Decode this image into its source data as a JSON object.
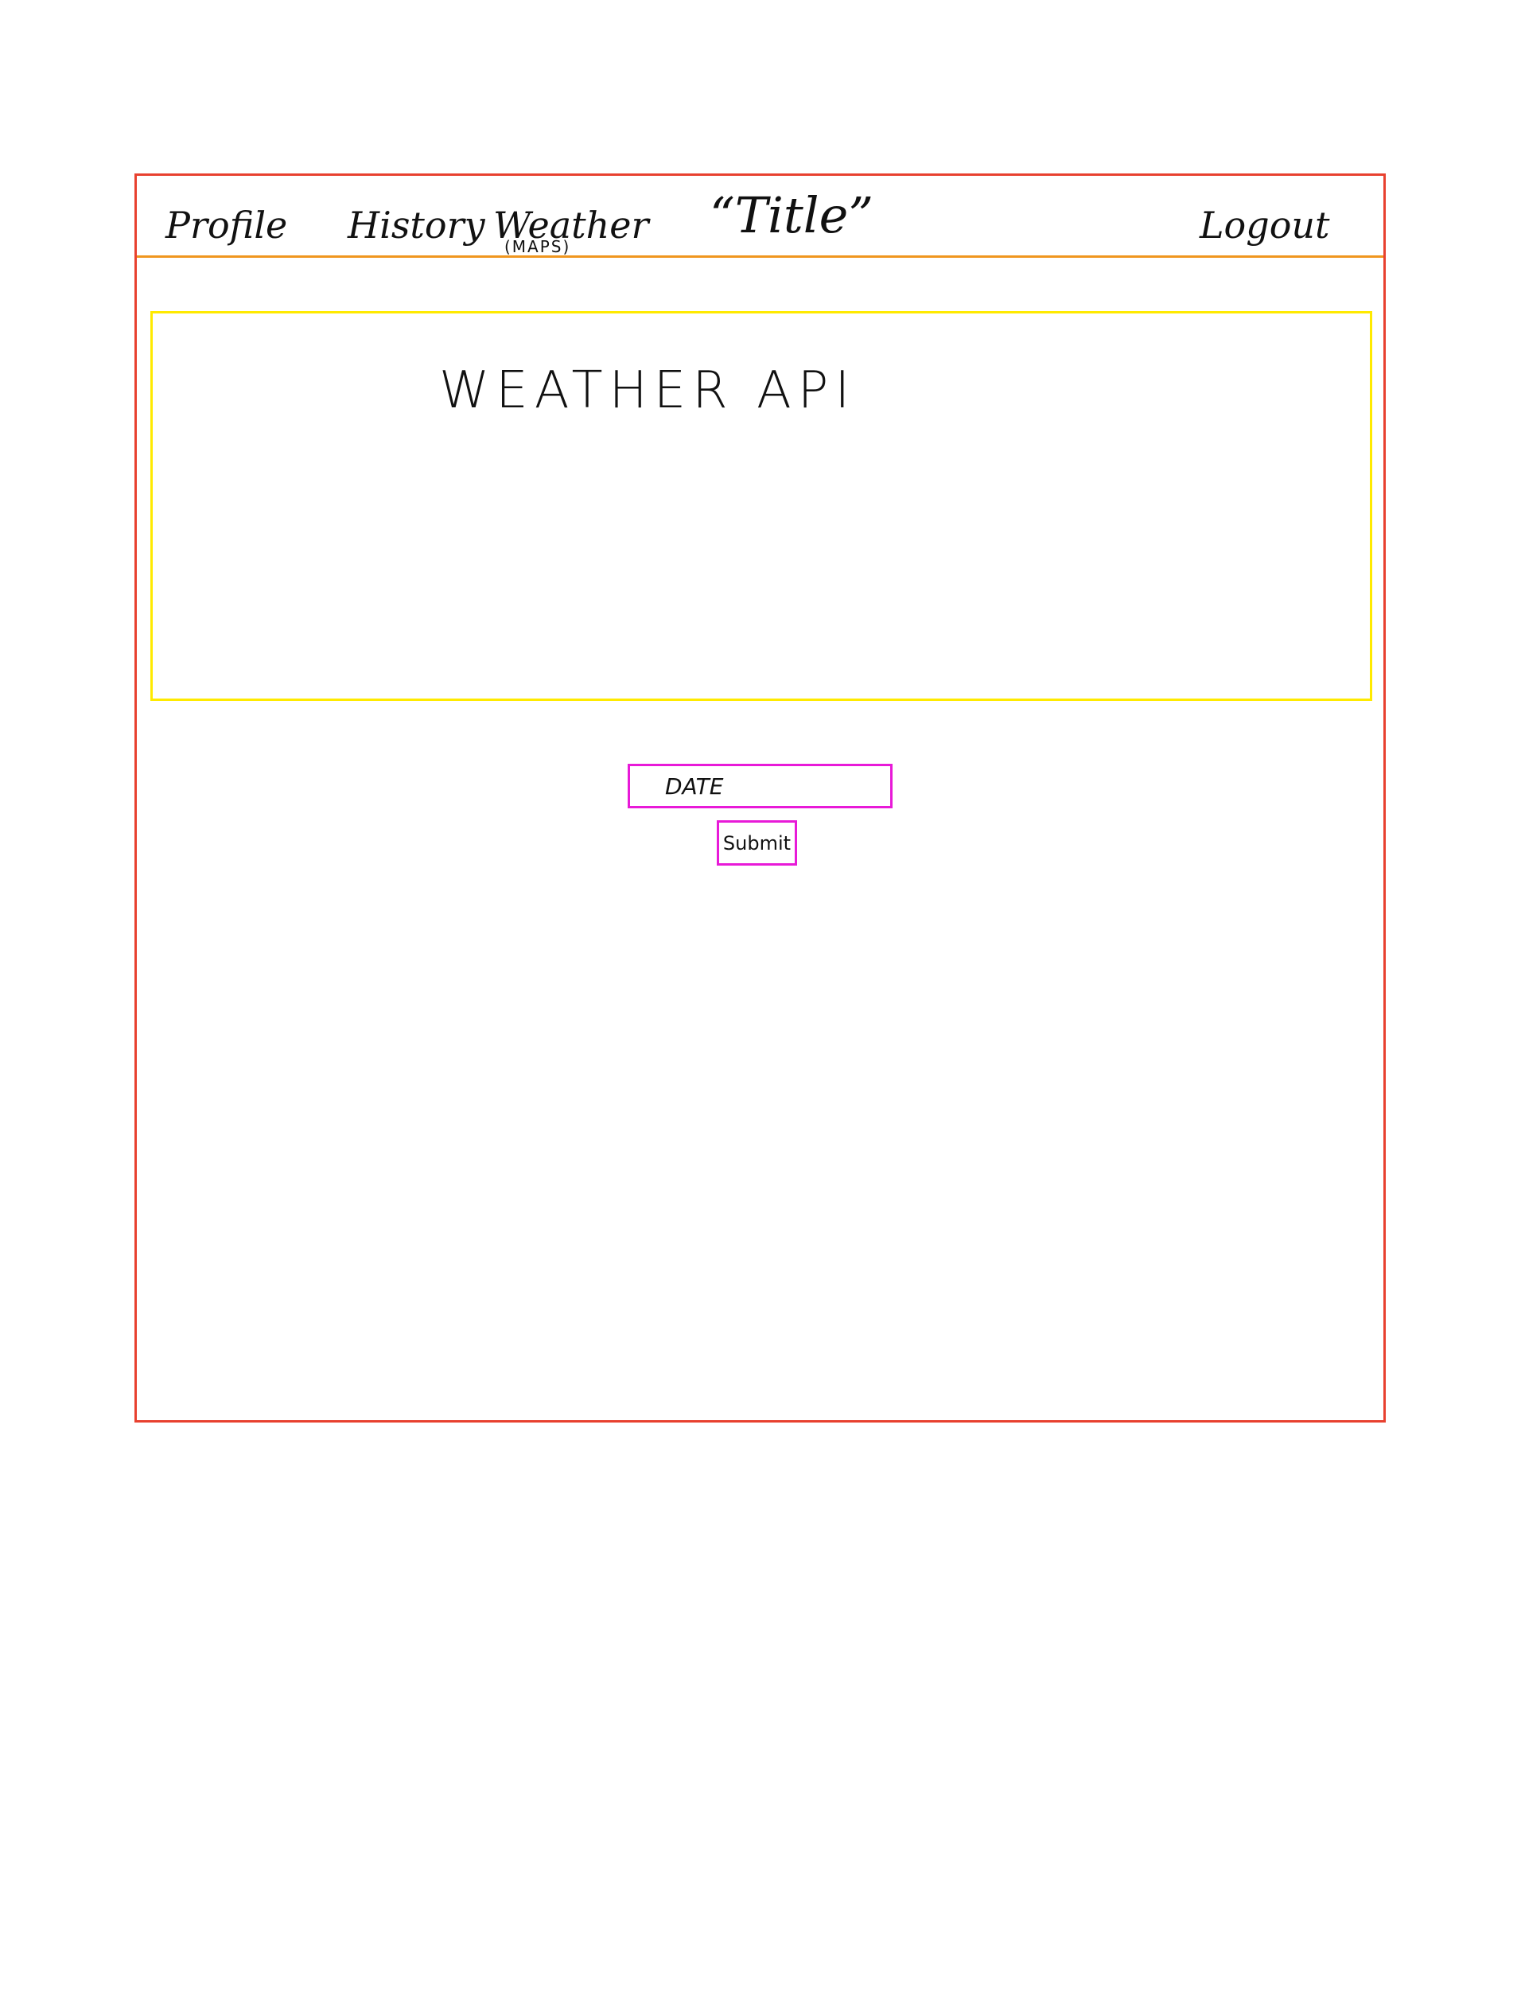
{
  "nav": {
    "profile": "Profile",
    "history": "History",
    "weather": "Weather",
    "weather_sub": "(MAPS)",
    "title": "“Title”",
    "logout": "Logout"
  },
  "main": {
    "api_label": "WEATHER API",
    "date_placeholder": "DATE",
    "submit_label": "Submit"
  },
  "colors": {
    "frame": "#e8412f",
    "nav_divider": "#f0961e",
    "api_panel": "#ffea00",
    "form_controls": "#e81ad8"
  }
}
